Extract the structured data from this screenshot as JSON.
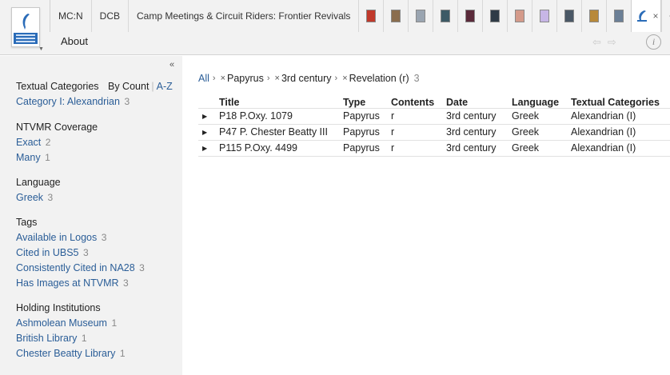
{
  "tabs": [
    {
      "label": "MC:N"
    },
    {
      "label": "DCB"
    },
    {
      "label": "Camp Meetings & Circuit Riders: Frontier Revivals"
    }
  ],
  "cover_tabs": [
    {
      "color": "#c0392b"
    },
    {
      "color": "#8a6d4e"
    },
    {
      "color": "#9aa5b1"
    },
    {
      "color": "#3d5a66"
    },
    {
      "color": "#5a2a3a"
    },
    {
      "color": "#2f3b46"
    },
    {
      "color": "#d49a8a"
    },
    {
      "color": "#c7b6e6"
    },
    {
      "color": "#4a5866"
    },
    {
      "color": "#b8893a"
    },
    {
      "color": "#6b7f96"
    }
  ],
  "header": {
    "subtitle": "About",
    "add_tab": "+",
    "close_tab": "×",
    "back_arrow": "⇦",
    "forward_arrow": "⇨",
    "info_glyph": "i"
  },
  "sidebar": {
    "collapse_glyph": "«",
    "sort": {
      "by_count": "By Count",
      "az": "A-Z"
    },
    "facets": [
      {
        "title": "Textual Categories",
        "items": [
          {
            "label": "Category I: Alexandrian",
            "count": "3"
          }
        ]
      },
      {
        "title": "NTVMR Coverage",
        "items": [
          {
            "label": "Exact",
            "count": "2"
          },
          {
            "label": "Many",
            "count": "1"
          }
        ]
      },
      {
        "title": "Language",
        "items": [
          {
            "label": "Greek",
            "count": "3"
          }
        ]
      },
      {
        "title": "Tags",
        "items": [
          {
            "label": "Available in Logos",
            "count": "3"
          },
          {
            "label": "Cited in UBS5",
            "count": "3"
          },
          {
            "label": "Consistently Cited in NA28",
            "count": "3"
          },
          {
            "label": "Has Images at NTVMR",
            "count": "3"
          }
        ]
      },
      {
        "title": "Holding Institutions",
        "items": [
          {
            "label": "Ashmolean Museum",
            "count": "1"
          },
          {
            "label": "British Library",
            "count": "1"
          },
          {
            "label": "Chester Beatty Library",
            "count": "1"
          }
        ]
      }
    ]
  },
  "breadcrumb": {
    "all": "All",
    "filters": [
      "Papyrus",
      "3rd century",
      "Revelation (r)"
    ],
    "count": "3"
  },
  "table": {
    "headers": [
      "Title",
      "Type",
      "Contents",
      "Date",
      "Language",
      "Textual Categories"
    ],
    "rows": [
      [
        "P18 P.Oxy. 1079",
        "Papyrus",
        "r",
        "3rd century",
        "Greek",
        "Alexandrian (I)"
      ],
      [
        "P47 P. Chester Beatty III",
        "Papyrus",
        "r",
        "3rd century",
        "Greek",
        "Alexandrian (I)"
      ],
      [
        "P115 P.Oxy. 4499",
        "Papyrus",
        "r",
        "3rd century",
        "Greek",
        "Alexandrian (I)"
      ]
    ]
  },
  "colors": {
    "link": "#2a5d97",
    "sidebar_bg": "#f2f2f2",
    "header_bg": "#f2f2f2"
  }
}
